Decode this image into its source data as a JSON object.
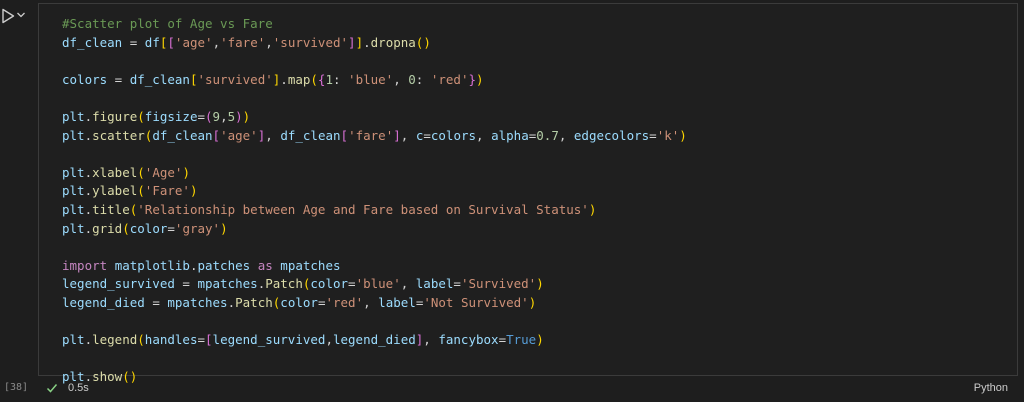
{
  "cell": {
    "execution_count": "[38]",
    "language": "Python",
    "duration": "0.5s",
    "status": "success"
  },
  "colors": {
    "editor_bg": "#1f1f1f",
    "comment": "#6a9955",
    "string": "#ce9178",
    "number": "#b5cea8",
    "function": "#dcdcaa",
    "variable": "#9cdcfe",
    "keyword_import": "#c586c0",
    "keyword_const": "#569cd6",
    "success": "#89d185"
  },
  "icons": {
    "run": "play-icon",
    "run_menu": "chevron-down-icon",
    "status": "check-icon"
  },
  "code_lines": [
    "#Scatter plot of Age vs Fare",
    "df_clean = df[['age','fare','survived']].dropna()",
    "",
    "colors = df_clean['survived'].map({1: 'blue', 0: 'red'})",
    "",
    "plt.figure(figsize=(9,5))",
    "plt.scatter(df_clean['age'], df_clean['fare'], c=colors, alpha=0.7, edgecolors='k')",
    "",
    "plt.xlabel('Age')",
    "plt.ylabel('Fare')",
    "plt.title('Relationship between Age and Fare based on Survival Status')",
    "plt.grid(color='gray')",
    "",
    "import matplotlib.patches as mpatches",
    "legend_survived = mpatches.Patch(color='blue', label='Survived')",
    "legend_died = mpatches.Patch(color='red', label='Not Survived')",
    "",
    "plt.legend(handles=[legend_survived,legend_died], fancybox=True)",
    "",
    "plt.show()"
  ]
}
